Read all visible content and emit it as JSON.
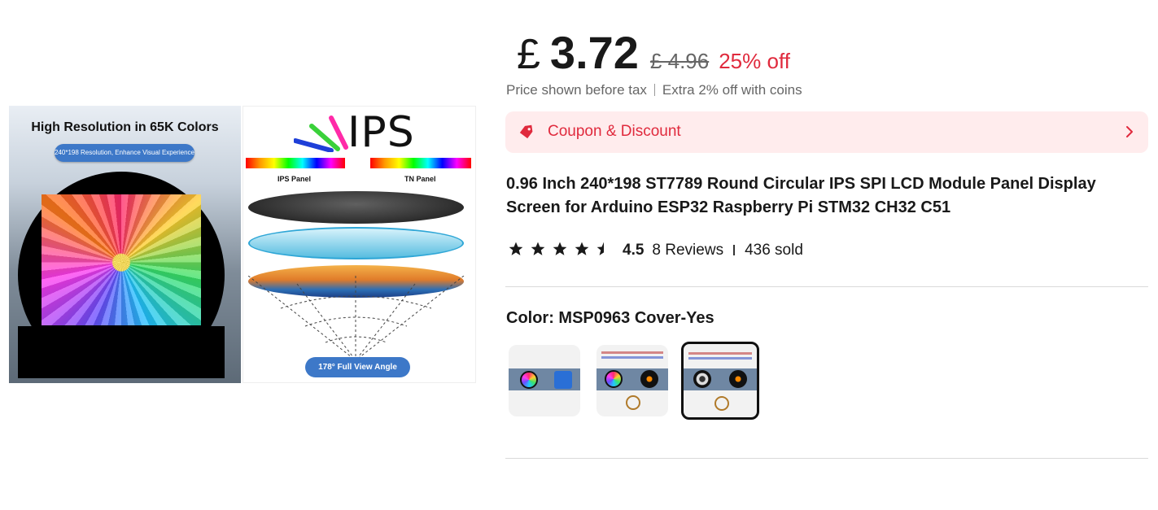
{
  "gallery": {
    "left_image": {
      "heading": "High Resolution in 65K Colors",
      "pill": "240*198 Resolution, Enhance Visual Experience"
    },
    "right_image": {
      "logo_text": "IPS",
      "ips_panel_label": "IPS Panel",
      "tn_panel_label": "TN Panel",
      "angle_pill": "178° Full View Angle"
    }
  },
  "price": {
    "currency_symbol": "£",
    "current": "3.72",
    "original": "£ 4.96",
    "discount": "25% off"
  },
  "tax_note": {
    "before_tax": "Price shown before tax",
    "coins": "Extra 2% off with coins"
  },
  "coupon": {
    "label": "Coupon & Discount",
    "accent_color": "#e02a3d",
    "background": "#ffeced",
    "icon": "price-tag-icon"
  },
  "product": {
    "title": "0.96 Inch 240*198 ST7789 Round Circular IPS SPI LCD Module Panel Display Screen for Arduino ESP32 Raspberry Pi STM32 CH32 C51"
  },
  "rating": {
    "stars_filled": 4.5,
    "stars_max": 5,
    "value": "4.5",
    "reviews": "8 Reviews",
    "sold": "436 sold"
  },
  "color_selector": {
    "label": "Color: MSP0963 Cover-Yes",
    "options": [
      {
        "name": "swatch-1",
        "selected": false
      },
      {
        "name": "swatch-2",
        "selected": false
      },
      {
        "name": "swatch-3",
        "selected": true
      }
    ]
  }
}
